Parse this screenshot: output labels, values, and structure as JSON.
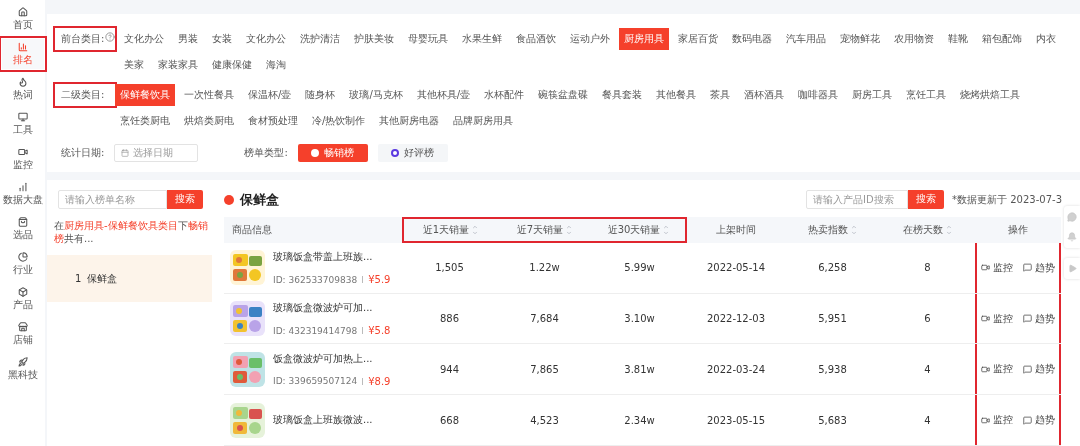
{
  "sidebar": {
    "items": [
      {
        "label": "首页",
        "selected": false,
        "highlighted": false
      },
      {
        "label": "排名",
        "selected": true,
        "highlighted": true
      },
      {
        "label": "热词",
        "selected": false,
        "highlighted": false
      },
      {
        "label": "工具",
        "selected": false,
        "highlighted": false
      },
      {
        "label": "监控",
        "selected": false,
        "highlighted": false
      },
      {
        "label": "数据大盘",
        "selected": false,
        "highlighted": false
      },
      {
        "label": "选品",
        "selected": false,
        "highlighted": false
      },
      {
        "label": "行业",
        "selected": false,
        "highlighted": false
      },
      {
        "label": "产品",
        "selected": false,
        "highlighted": false
      },
      {
        "label": "店铺",
        "selected": false,
        "highlighted": false
      },
      {
        "label": "黑科技",
        "selected": false,
        "highlighted": false
      }
    ]
  },
  "filters": {
    "front_category": {
      "label": "前台类目:",
      "highlighted": true,
      "items": [
        {
          "label": "文化办公",
          "selected": false
        },
        {
          "label": "男装",
          "selected": false
        },
        {
          "label": "女装",
          "selected": false
        },
        {
          "label": "文化办公",
          "selected": false
        },
        {
          "label": "洗护清洁",
          "selected": false
        },
        {
          "label": "护肤美妆",
          "selected": false
        },
        {
          "label": "母婴玩具",
          "selected": false
        },
        {
          "label": "水果生鲜",
          "selected": false
        },
        {
          "label": "食品酒饮",
          "selected": false
        },
        {
          "label": "运动户外",
          "selected": false
        },
        {
          "label": "厨房用具",
          "selected": true
        },
        {
          "label": "家居百货",
          "selected": false
        },
        {
          "label": "数码电器",
          "selected": false
        },
        {
          "label": "汽车用品",
          "selected": false
        },
        {
          "label": "宠物鲜花",
          "selected": false
        },
        {
          "label": "农用物资",
          "selected": false
        },
        {
          "label": "鞋靴",
          "selected": false
        },
        {
          "label": "箱包配饰",
          "selected": false
        },
        {
          "label": "内衣",
          "selected": false
        },
        {
          "label": "美家",
          "selected": false
        },
        {
          "label": "家装家具",
          "selected": false
        },
        {
          "label": "健康保健",
          "selected": false
        },
        {
          "label": "海淘",
          "selected": false
        }
      ]
    },
    "second_category": {
      "label": "二级类目:",
      "highlighted": true,
      "items": [
        {
          "label": "保鲜餐饮具",
          "selected": true
        },
        {
          "label": "一次性餐具",
          "selected": false
        },
        {
          "label": "保温杯/壶",
          "selected": false
        },
        {
          "label": "随身杯",
          "selected": false
        },
        {
          "label": "玻璃/马克杯",
          "selected": false
        },
        {
          "label": "其他杯具/壶",
          "selected": false
        },
        {
          "label": "水杯配件",
          "selected": false
        },
        {
          "label": "碗筷盆盘碟",
          "selected": false
        },
        {
          "label": "餐具套装",
          "selected": false
        },
        {
          "label": "其他餐具",
          "selected": false
        },
        {
          "label": "茶具",
          "selected": false
        },
        {
          "label": "酒杯酒具",
          "selected": false
        },
        {
          "label": "咖啡器具",
          "selected": false
        },
        {
          "label": "厨房工具",
          "selected": false
        },
        {
          "label": "烹饪工具",
          "selected": false
        },
        {
          "label": "烧烤烘焙工具",
          "selected": false
        },
        {
          "label": "烹饪类厨电",
          "selected": false
        },
        {
          "label": "烘焙类厨电",
          "selected": false
        },
        {
          "label": "食材预处理",
          "selected": false
        },
        {
          "label": "冷/热饮制作",
          "selected": false
        },
        {
          "label": "其他厨房电器",
          "selected": false
        },
        {
          "label": "品牌厨房用具",
          "selected": false
        }
      ]
    },
    "date": {
      "label": "统计日期:",
      "placeholder": "选择日期"
    },
    "list_type": {
      "label": "榜单类型:",
      "options": [
        {
          "label": "畅销榜",
          "selected": true
        },
        {
          "label": "好评榜",
          "selected": false
        }
      ]
    }
  },
  "list_panel": {
    "search": {
      "placeholder": "请输入榜单名称",
      "button": "搜索"
    },
    "summary": [
      {
        "text": "在",
        "accent": false
      },
      {
        "text": "厨房用具-保鲜餐饮具类目",
        "accent": true
      },
      {
        "text": "下",
        "accent": false
      },
      {
        "text": "畅销榜",
        "accent": true
      },
      {
        "text": "共有...",
        "accent": false
      }
    ],
    "items": [
      {
        "rank": "1",
        "name": "保鲜盒",
        "selected": true
      }
    ]
  },
  "ranking": {
    "title": "保鲜盒",
    "search": {
      "placeholder": "请输入产品ID搜索",
      "button": "搜索"
    },
    "note": "*数据更新于 2023-07-3",
    "columns": [
      {
        "label": "商品信息",
        "sortable": false,
        "highlighted": false
      },
      {
        "label": "近1天销量",
        "sortable": true,
        "highlighted": true
      },
      {
        "label": "近7天销量",
        "sortable": true,
        "highlighted": true
      },
      {
        "label": "近30天销量",
        "sortable": true,
        "highlighted": true
      },
      {
        "label": "上架时间",
        "sortable": false,
        "highlighted": false
      },
      {
        "label": "热卖指数",
        "sortable": true,
        "highlighted": false
      },
      {
        "label": "在榜天数",
        "sortable": true,
        "highlighted": false
      },
      {
        "label": "操作",
        "sortable": false,
        "highlighted": false
      }
    ],
    "actions_highlighted": true,
    "rows": [
      {
        "title": "玻璃饭盒带盖上班族...",
        "id": "ID: 362533709838",
        "price": "¥5.9",
        "d1": "1,505",
        "d7": "1.22w",
        "d30": "5.99w",
        "listed": "2022-05-14",
        "hot": "6,258",
        "days": "8",
        "actions": [
          "监控",
          "趋势"
        ]
      },
      {
        "title": "玻璃饭盒微波炉可加...",
        "id": "ID: 432319414798",
        "price": "¥5.8",
        "d1": "886",
        "d7": "7,684",
        "d30": "3.10w",
        "listed": "2022-12-03",
        "hot": "5,951",
        "days": "6",
        "actions": [
          "监控",
          "趋势"
        ]
      },
      {
        "title": "饭盒微波炉可加热上...",
        "id": "ID: 339659507124",
        "price": "¥8.9",
        "d1": "944",
        "d7": "7,865",
        "d30": "3.81w",
        "listed": "2022-03-24",
        "hot": "5,938",
        "days": "4",
        "actions": [
          "监控",
          "趋势"
        ]
      },
      {
        "title": "玻璃饭盒上班族微波...",
        "d1": "668",
        "d7": "4,523",
        "d30": "2.34w",
        "listed": "2023-05-15",
        "hot": "5,683",
        "days": "4",
        "actions": [
          "监控",
          "趋势"
        ]
      }
    ]
  }
}
